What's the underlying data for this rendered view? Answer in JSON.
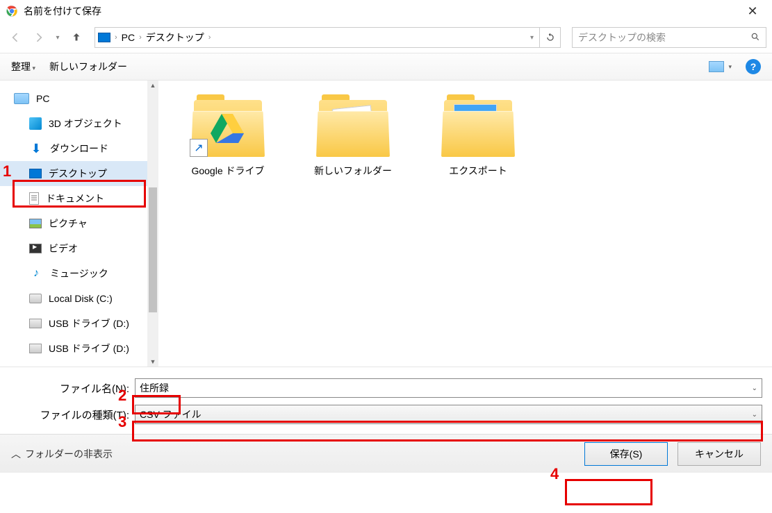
{
  "window": {
    "title": "名前を付けて保存"
  },
  "breadcrumb": {
    "items": [
      "PC",
      "デスクトップ"
    ]
  },
  "search": {
    "placeholder": "デスクトップの検索"
  },
  "toolbar": {
    "organize": "整理",
    "newFolder": "新しいフォルダー"
  },
  "tree": {
    "root": "PC",
    "items": [
      {
        "label": "3D オブジェクト"
      },
      {
        "label": "ダウンロード"
      },
      {
        "label": "デスクトップ",
        "selected": true
      },
      {
        "label": "ドキュメント"
      },
      {
        "label": "ピクチャ"
      },
      {
        "label": "ビデオ"
      },
      {
        "label": "ミュージック"
      },
      {
        "label": "Local Disk (C:)"
      },
      {
        "label": "USB ドライブ (D:)"
      },
      {
        "label": "USB ドライブ (D:)"
      }
    ]
  },
  "files": [
    {
      "name": "Google ドライブ"
    },
    {
      "name": "新しいフォルダー"
    },
    {
      "name": "エクスポート"
    }
  ],
  "fields": {
    "filenameLabel": "ファイル名(N):",
    "filenameValue": "住所録",
    "filetypeLabel": "ファイルの種類(T):",
    "filetypeValue": "CSV ファイル"
  },
  "footer": {
    "hideFolders": "フォルダーの非表示",
    "save": "保存(S)",
    "cancel": "キャンセル"
  },
  "annotations": {
    "n1": "1",
    "n2": "2",
    "n3": "3",
    "n4": "4"
  },
  "help": "?"
}
